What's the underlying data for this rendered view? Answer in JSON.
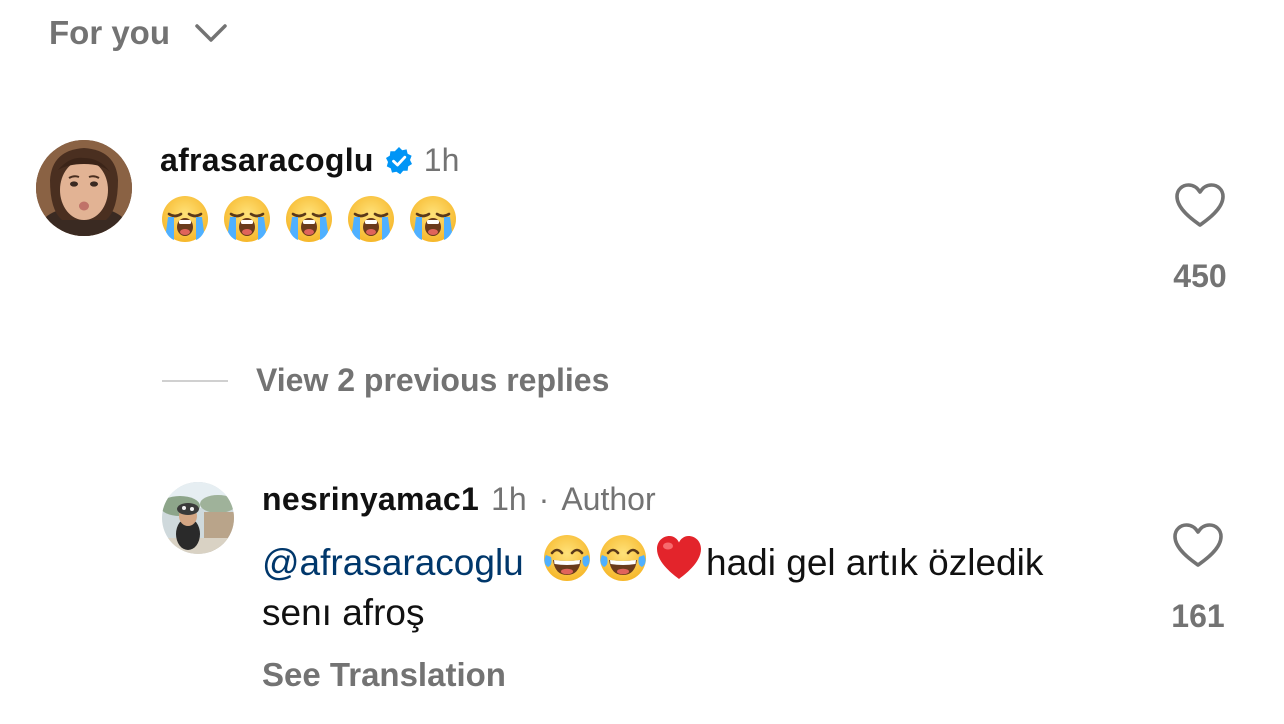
{
  "header": {
    "sort_label": "For you",
    "sort_icon": "chevron-down-icon"
  },
  "comment": {
    "username": "afrasaracoglu",
    "verified": true,
    "time": "1h",
    "emoji_count": 5,
    "emoji": "loudly-crying-face",
    "likes": "450"
  },
  "view_replies": {
    "label": "View 2 previous replies"
  },
  "reply": {
    "username": "nesrinyamac1",
    "time": "1h",
    "separator": "·",
    "badge": "Author",
    "mention": "@afrasaracoglu",
    "emojis": [
      "face-with-tears-of-joy",
      "face-with-tears-of-joy",
      "red-heart"
    ],
    "text": "hadi gel artık özledik senı afroş",
    "likes": "161",
    "see_translation": "See Translation"
  },
  "colors": {
    "muted": "#737373",
    "mention": "#00376b",
    "verified": "#0095f6",
    "heart_red": "#e3242b"
  }
}
